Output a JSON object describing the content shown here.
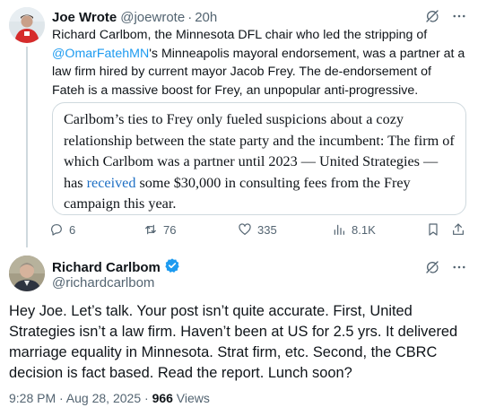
{
  "parent_tweet": {
    "author_name": "Joe Wrote",
    "handle": "@joewrote",
    "separator": "·",
    "time": "20h",
    "text_before_mention": "Richard Carlbom, the Minnesota DFL chair who led the stripping of ",
    "mention": "@OmarFatehMN",
    "text_after_mention": "'s Minneapolis mayoral endorsement, was a partner at a law firm hired by current mayor Jacob Frey. The de-endorsement of Fateh is a massive boost for Frey, an unpopular anti-progressive.",
    "quote": {
      "text_before_link": "Carlbom’s ties to Frey only fueled suspicions about a cozy relationship between the state party and the incumbent: The firm of which Carlbom was a partner until 2023 — United Strategies — has ",
      "link_text": "received",
      "text_after_link": " some $30,000 in consulting fees from the Frey campaign this year."
    },
    "actions": {
      "replies": "6",
      "retweets": "76",
      "likes": "335",
      "views": "8.1K"
    }
  },
  "main_tweet": {
    "author_name": "Richard Carlbom",
    "handle": "@richardcarlbom",
    "text": "Hey Joe. Let’s talk. Your post isn’t quite accurate. First, United Strategies isn’t a law firm. Haven’t been at US for 2.5 yrs. It delivered marriage equality in Minnesota. Strat firm, etc. Second, the CBRC decision is fact based. Read the report. Lunch soon?",
    "timestamp": "9:28 PM · Aug 28, 2025",
    "separator": " · ",
    "views_count": "966",
    "views_label": " Views"
  },
  "icons": {
    "grok": "grok-icon",
    "more": "more-icon",
    "verified": "verified-badge-icon",
    "reply": "reply-icon",
    "retweet": "retweet-icon",
    "like": "like-icon",
    "views": "views-icon",
    "bookmark": "bookmark-icon",
    "share": "share-icon"
  },
  "colors": {
    "link": "#1d9bf0",
    "verified": "#1d9bf0",
    "secondary_text": "#536471",
    "border": "#cfd9de"
  }
}
